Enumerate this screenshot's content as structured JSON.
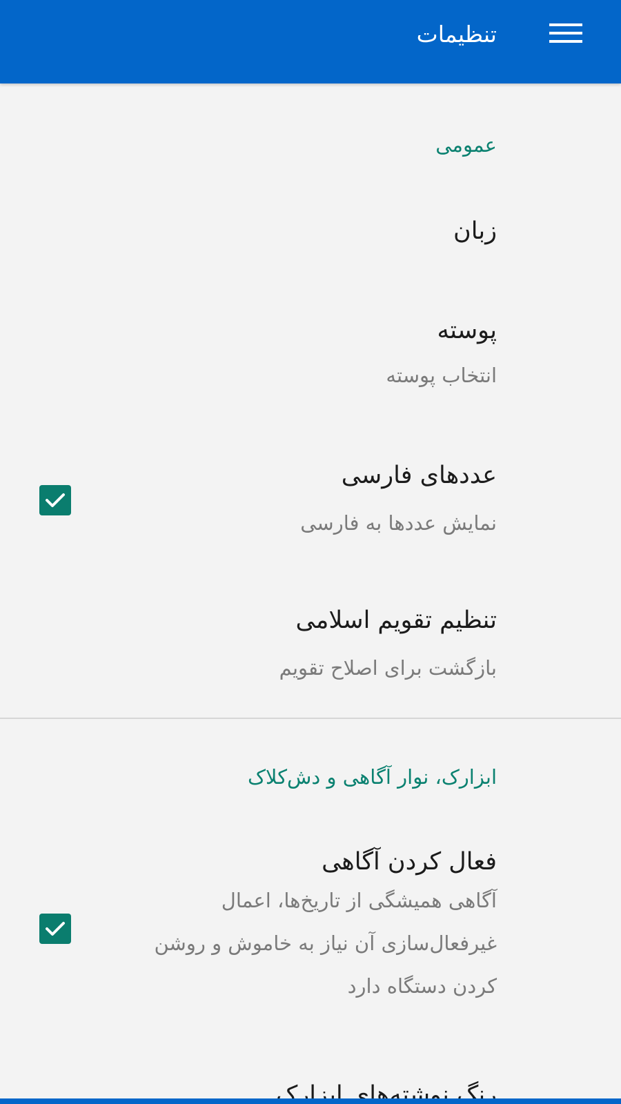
{
  "appbar": {
    "title": "تنظیمات",
    "menu_icon": "hamburger-menu-icon",
    "background": "#0366c9"
  },
  "sections": {
    "general": {
      "header": "عمومی",
      "language": {
        "title": "زبان"
      },
      "skin": {
        "title": "پوسته",
        "summary": "انتخاب پوسته"
      },
      "persian_digits": {
        "title": "عددهای فارسی",
        "summary": "نمایش عددها به فارسی",
        "checked": true
      },
      "islamic_calendar": {
        "title": "تنظیم تقویم اسلامی",
        "summary": "بازگشت برای اصلاح تقویم"
      }
    },
    "widgets": {
      "header": "ابزارک، نوار آگاهی و دش‌کلاک",
      "notification": {
        "title": "فعال کردن آگاهی",
        "summary": "آگاهی همیشگی از تاریخ‌ها، اعمال غیرفعال‌سازی آن نیاز به خاموش و روشن کردن دستگاه دارد",
        "checked": true
      },
      "widget_text_color": {
        "title": "رنگ نوشته‌های ابزارک"
      }
    }
  },
  "colors": {
    "accent": "#0a8170",
    "checkbox": "#0a7d6e",
    "background": "#f3f3f3"
  }
}
